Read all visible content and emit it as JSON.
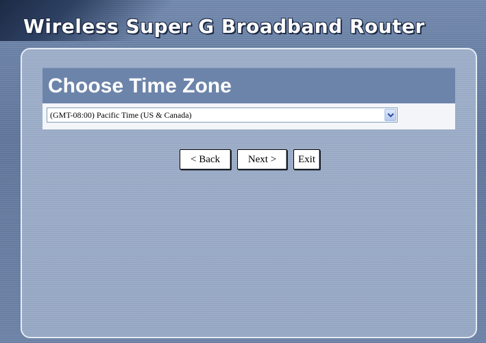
{
  "header": {
    "title": "Wireless Super G Broadband Router"
  },
  "section": {
    "title": "Choose Time Zone"
  },
  "timezone": {
    "selected": "(GMT-08:00) Pacific Time (US & Canada)"
  },
  "buttons": {
    "back": "< Back",
    "next": "Next >",
    "exit": "Exit"
  },
  "icons": {
    "dropdown": "chevron-down-icon"
  },
  "colors": {
    "panel": "#93a5c2",
    "header_bar": "#6d84aa",
    "frame": "#5d7398"
  }
}
